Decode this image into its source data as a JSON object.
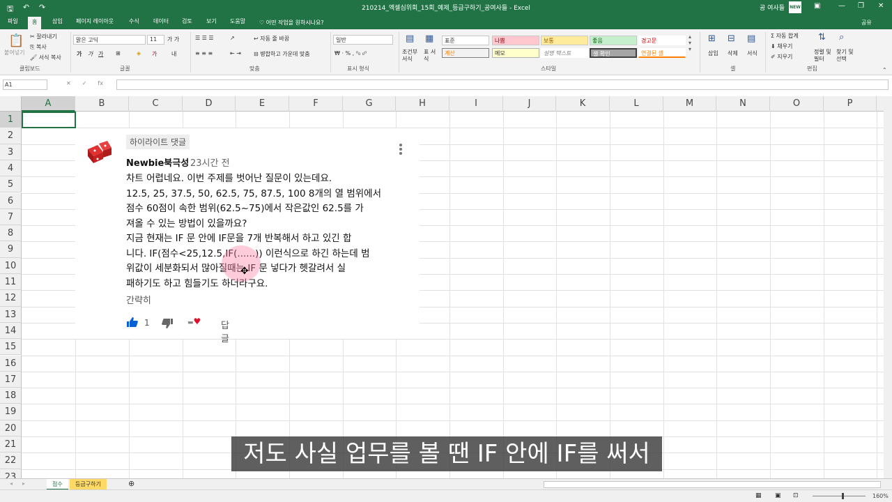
{
  "titlebar": {
    "doc_title": "210214_엑셀심위회_15회_예제_등급구하기_공여사들 - Excel",
    "account": "공 여사들",
    "avatar_text": "NEW"
  },
  "tabs": [
    "파일",
    "홈",
    "삽입",
    "페이지 레이아웃",
    "수식",
    "데이터",
    "검토",
    "보기",
    "도움말"
  ],
  "tell_me": "어떤 작업을 원하시나요?",
  "share": "공유",
  "ribbon": {
    "clipboard": {
      "paste": "붙여넣기",
      "cut": "잘라내기",
      "copy": "복사",
      "format_painter": "서식 복사",
      "label": "클립보드"
    },
    "font": {
      "name": "맑은 고딕",
      "size": "11",
      "label": "글꼴"
    },
    "align": {
      "wrap": "자동 줄 바꿈",
      "merge": "병합하고 가운데 맞춤",
      "label": "맞춤"
    },
    "number": {
      "format": "일반",
      "label": "표시 형식"
    },
    "styles": {
      "cond_format": "조건부 서식",
      "as_table": "표 서식",
      "cells": [
        "표준",
        "나쁨",
        "보통",
        "좋음",
        "경고문",
        "계산",
        "메모",
        "설명 텍스트",
        "셀 확인",
        "연결된 셀"
      ],
      "label": "스타일"
    },
    "cells_grp": {
      "insert": "삽입",
      "delete": "삭제",
      "format": "서식",
      "label": "셀"
    },
    "edit": {
      "autosum": "자동 합계",
      "fill": "채우기",
      "clear": "지우기",
      "sort": "정렬 및 필터",
      "find": "찾기 및 선택",
      "label": "편집"
    }
  },
  "namebox": "A1",
  "columns": [
    "A",
    "B",
    "C",
    "D",
    "E",
    "F",
    "G",
    "H",
    "I",
    "J",
    "K",
    "L",
    "M",
    "N",
    "O",
    "P"
  ],
  "rows": [
    "1",
    "2",
    "3",
    "4",
    "5",
    "6",
    "7",
    "8",
    "9",
    "10",
    "11",
    "12",
    "13",
    "14",
    "15",
    "16",
    "17",
    "18",
    "19",
    "20",
    "21",
    "22",
    "23"
  ],
  "comment": {
    "badge": "하이라이트 댓글",
    "author": "Newbie북극성",
    "time": "23시간 전",
    "lines": [
      "차트 어렵네요. 이번 주제를 벗어난 질문이 있는데요.",
      "12.5, 25, 37.5, 50, 62.5, 75, 87.5, 100 8개의 열 범위에서",
      "점수 60점이 속한 범위(62.5~75)에서 작은값인 62.5를 가",
      "져올 수 있는 방법이 있을까요?",
      "지금 현재는  IF 문 안에 IF문을 7개 반복해서 하고 있긴 합",
      "니다. IF(점수<25,12.5,IF(......)) 이런식으로 하긴 하는데 범",
      "위값이 세분화되서 많아질때는 IF 문 넣다가 헷갈려서 실",
      "패하기도 하고 힘들기도 하더라구요."
    ],
    "brief": "간략히",
    "likes": "1",
    "reply": "답글"
  },
  "subtitle": "저도 사실 업무를 볼 땐 IF 안에 IF를 써서",
  "sheets": [
    "점수",
    "등급구하기"
  ],
  "zoom": "160%",
  "colors": {
    "excel_green": "#217346",
    "subtitle_bg": "#3c3c3c",
    "like_blue": "#065fd4"
  }
}
